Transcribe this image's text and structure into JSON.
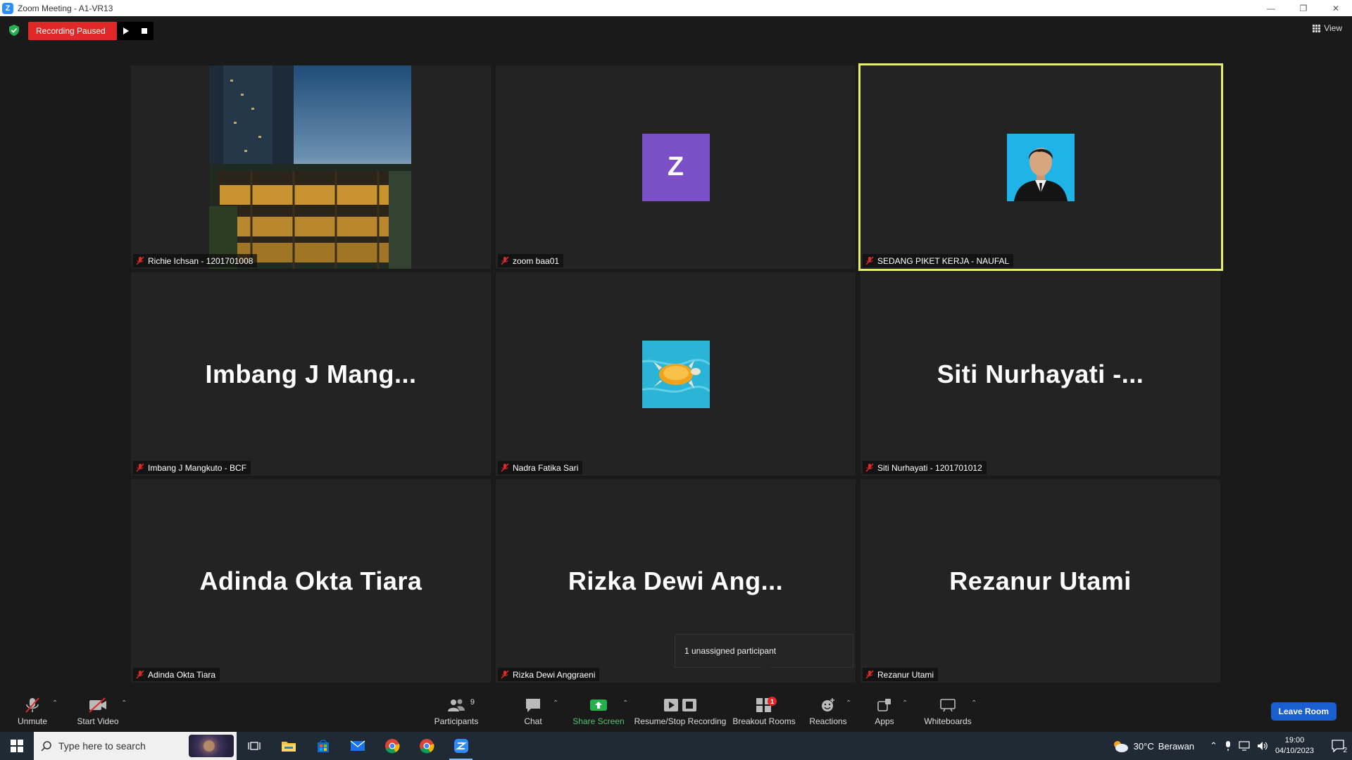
{
  "window": {
    "title": "Zoom Meeting - A1-VR13",
    "logo_letter": "Z"
  },
  "recording": {
    "status": "Recording Paused"
  },
  "view": {
    "label": "View"
  },
  "tiles": [
    {
      "display": "photo",
      "name": "Richie Ichsan - 1201701008"
    },
    {
      "display": "letter",
      "letter": "Z",
      "name": "zoom baa01"
    },
    {
      "display": "photo",
      "name": "SEDANG PIKET KERJA - NAUFAL",
      "active": true
    },
    {
      "display": "text",
      "big_name": "Imbang J Mang...",
      "name": "Imbang J Mangkuto - BCF"
    },
    {
      "display": "photo",
      "name": "Nadra Fatika Sari"
    },
    {
      "display": "text",
      "big_name": "Siti Nurhayati -...",
      "name": "Siti Nurhayati - 1201701012"
    },
    {
      "display": "text",
      "big_name": "Adinda Okta Tiara",
      "name": "Adinda Okta Tiara"
    },
    {
      "display": "text",
      "big_name": "Rizka Dewi Ang...",
      "name": "Rizka Dewi Anggraeni"
    },
    {
      "display": "text",
      "big_name": "Rezanur Utami",
      "name": "Rezanur Utami"
    }
  ],
  "tooltip": {
    "text": "1 unassigned participant"
  },
  "toolbar": {
    "unmute": "Unmute",
    "start_video": "Start Video",
    "participants": "Participants",
    "participants_count": "9",
    "chat": "Chat",
    "share_screen": "Share Screen",
    "recording": "Resume/Stop Recording",
    "breakout": "Breakout Rooms",
    "breakout_badge": "1",
    "reactions": "Reactions",
    "apps": "Apps",
    "whiteboards": "Whiteboards",
    "leave": "Leave Room"
  },
  "taskbar": {
    "search_placeholder": "Type here to search",
    "weather_temp": "30°C",
    "weather_desc": "Berawan",
    "time": "19:00",
    "date": "04/10/2023",
    "notifications": "2"
  },
  "colors": {
    "accent": "#2d8cff",
    "recording_red": "#e02828",
    "active_speaker": "#e6ec6d",
    "share_green": "#4fc36a",
    "leave_blue": "#1a5fd0"
  }
}
